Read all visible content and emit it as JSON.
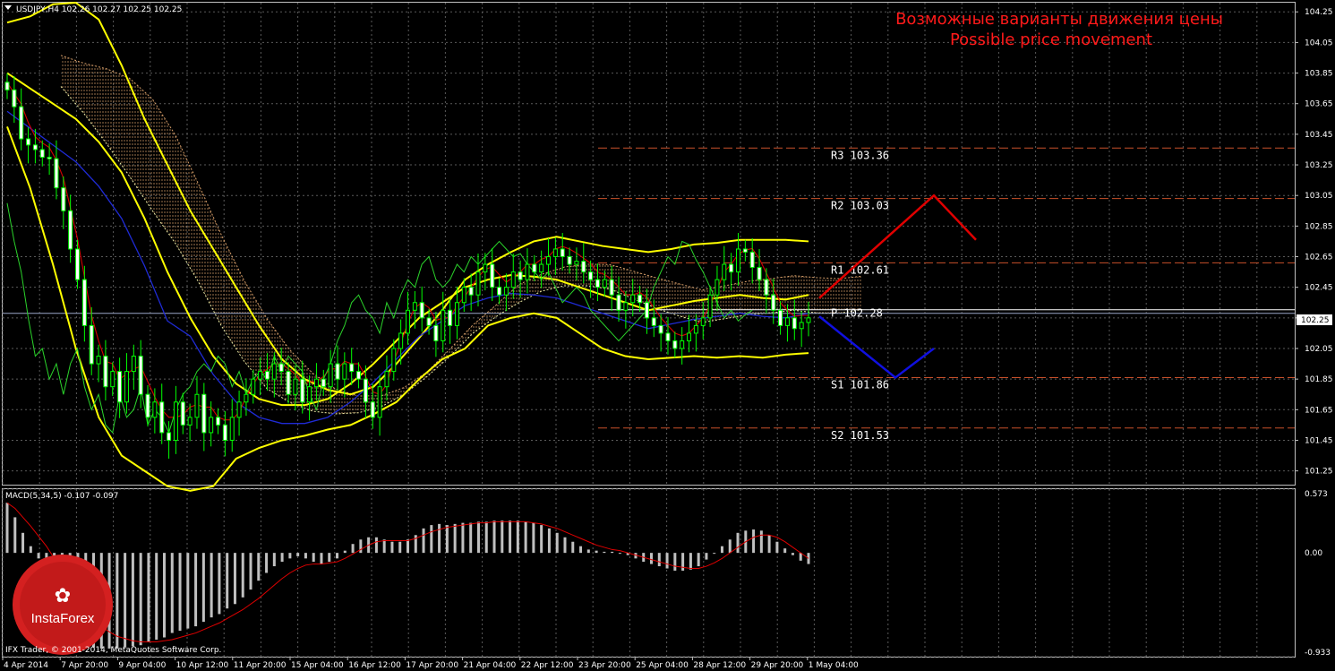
{
  "chart_data": {
    "type": "candlestick",
    "symbol_header": "USDJPY,H4  102.26 102.27 102.25 102.25",
    "annotation": {
      "ru": "Возможные варианты движения цены",
      "en": "Possible price movement"
    },
    "current_price": "102.25",
    "price_axis": {
      "ylim": [
        101.16,
        104.31
      ],
      "ticks": [
        "104.25",
        "104.05",
        "103.85",
        "103.65",
        "103.45",
        "103.25",
        "103.05",
        "102.85",
        "102.65",
        "102.45",
        "102.25",
        "102.05",
        "101.85",
        "101.65",
        "101.45",
        "101.25"
      ]
    },
    "levels": [
      {
        "label": "R3 103.36",
        "value": 103.36,
        "color": "#c8502a",
        "style": "dashed"
      },
      {
        "label": "R2 103.03",
        "value": 103.03,
        "color": "#c8502a",
        "style": "dashed"
      },
      {
        "label": "R1 102.61",
        "value": 102.61,
        "color": "#c8502a",
        "style": "dashed"
      },
      {
        "label": "P 102.28",
        "value": 102.28,
        "color": "#ffffff",
        "style": "solid"
      },
      {
        "label": "S1 101.86",
        "value": 101.86,
        "color": "#c8502a",
        "style": "dashed"
      },
      {
        "label": "S2 101.53",
        "value": 101.53,
        "color": "#c8502a",
        "style": "dashed"
      }
    ],
    "x_labels": [
      "4 Apr 2014",
      "7 Apr 20:00",
      "9 Apr 04:00",
      "10 Apr 12:00",
      "11 Apr 20:00",
      "15 Apr 04:00",
      "16 Apr 12:00",
      "17 Apr 20:00",
      "21 Apr 04:00",
      "22 Apr 12:00",
      "23 Apr 20:00",
      "25 Apr 04:00",
      "28 Apr 12:00",
      "29 Apr 20:00",
      "1 May 04:00"
    ],
    "projections": [
      {
        "name": "bullish",
        "color": "#e00000",
        "points": [
          [
            0,
            102.38
          ],
          [
            1,
            103.05
          ],
          [
            2,
            102.76
          ]
        ]
      },
      {
        "name": "bearish",
        "color": "#1010e0",
        "points": [
          [
            0,
            102.26
          ],
          [
            1,
            101.86
          ],
          [
            2,
            102.05
          ]
        ]
      }
    ],
    "macd": {
      "header": "MACD(5,34,5) -0.107 -0.097",
      "ylim": [
        -0.933,
        0.573
      ],
      "ticks": [
        "0.573",
        "0.00",
        "-0.933"
      ],
      "histogram": [
        0.45,
        0.32,
        0.18,
        0.06,
        -0.05,
        -0.18,
        -0.35,
        -0.55,
        -0.7,
        -0.78,
        -0.82,
        -0.85,
        -0.86,
        -0.86,
        -0.86,
        -0.85,
        -0.84,
        -0.83,
        -0.8,
        -0.78,
        -0.76,
        -0.72,
        -0.7,
        -0.68,
        -0.66,
        -0.62,
        -0.58,
        -0.55,
        -0.5,
        -0.46,
        -0.4,
        -0.33,
        -0.25,
        -0.18,
        -0.12,
        -0.08,
        -0.05,
        -0.03,
        -0.05,
        -0.08,
        -0.1,
        -0.08,
        -0.05,
        0.02,
        0.08,
        0.12,
        0.14,
        0.14,
        0.12,
        0.1,
        0.1,
        0.12,
        0.16,
        0.22,
        0.25,
        0.26,
        0.25,
        0.26,
        0.27,
        0.27,
        0.28,
        0.28,
        0.29,
        0.29,
        0.29,
        0.29,
        0.28,
        0.27,
        0.25,
        0.22,
        0.18,
        0.14,
        0.1,
        0.06,
        0.03,
        0.02,
        0.01,
        0.01,
        0.0,
        -0.02,
        -0.05,
        -0.08,
        -0.1,
        -0.12,
        -0.14,
        -0.16,
        -0.16,
        -0.15,
        -0.12,
        -0.06,
        0.0,
        0.06,
        0.12,
        0.18,
        0.2,
        0.21,
        0.2,
        0.16,
        0.1,
        0.04,
        -0.02,
        -0.07,
        -0.1
      ],
      "signal": [
        0.45,
        0.4,
        0.32,
        0.24,
        0.15,
        0.06,
        -0.05,
        -0.18,
        -0.3,
        -0.42,
        -0.52,
        -0.6,
        -0.66,
        -0.71,
        -0.75,
        -0.77,
        -0.79,
        -0.8,
        -0.8,
        -0.8,
        -0.79,
        -0.78,
        -0.76,
        -0.74,
        -0.72,
        -0.69,
        -0.66,
        -0.63,
        -0.59,
        -0.55,
        -0.51,
        -0.46,
        -0.41,
        -0.35,
        -0.29,
        -0.23,
        -0.18,
        -0.14,
        -0.11,
        -0.1,
        -0.1,
        -0.09,
        -0.08,
        -0.05,
        -0.01,
        0.03,
        0.07,
        0.1,
        0.11,
        0.11,
        0.11,
        0.11,
        0.13,
        0.16,
        0.19,
        0.21,
        0.23,
        0.24,
        0.25,
        0.26,
        0.27,
        0.27,
        0.28,
        0.28,
        0.28,
        0.28,
        0.28,
        0.27,
        0.26,
        0.24,
        0.22,
        0.19,
        0.16,
        0.13,
        0.1,
        0.07,
        0.05,
        0.03,
        0.02,
        0.0,
        -0.02,
        -0.04,
        -0.06,
        -0.08,
        -0.1,
        -0.12,
        -0.13,
        -0.14,
        -0.14,
        -0.12,
        -0.09,
        -0.05,
        0.0,
        0.05,
        0.1,
        0.14,
        0.16,
        0.16,
        0.14,
        0.1,
        0.05,
        0.0,
        -0.05
      ]
    },
    "series": [
      {
        "name": "close",
        "color": "#00ff00",
        "values": [
          103.74,
          103.63,
          103.42,
          103.38,
          103.35,
          103.3,
          103.29,
          103.1,
          102.95,
          102.7,
          102.5,
          102.2,
          101.95,
          102.0,
          101.8,
          101.9,
          101.7,
          101.9,
          102.0,
          101.75,
          101.6,
          101.7,
          101.5,
          101.45,
          101.7,
          101.55,
          101.6,
          101.75,
          101.5,
          101.6,
          101.55,
          101.45,
          101.6,
          101.7,
          101.75,
          101.85,
          101.9,
          101.85,
          101.95,
          101.9,
          101.75,
          101.85,
          101.7,
          101.8,
          101.85,
          101.8,
          101.95,
          101.85,
          101.95,
          101.9,
          101.85,
          101.7,
          101.6,
          101.8,
          101.9,
          102.05,
          102.15,
          102.3,
          102.35,
          102.25,
          102.2,
          102.1,
          102.3,
          102.2,
          102.35,
          102.45,
          102.4,
          102.55,
          102.6,
          102.45,
          102.4,
          102.45,
          102.55,
          102.5,
          102.6,
          102.55,
          102.6,
          102.65,
          102.7,
          102.65,
          102.6,
          102.62,
          102.55,
          102.5,
          102.45,
          102.5,
          102.4,
          102.3,
          102.35,
          102.4,
          102.35,
          102.25,
          102.2,
          102.15,
          102.1,
          102.05,
          102.1,
          102.15,
          102.2,
          102.25,
          102.4,
          102.5,
          102.6,
          102.55,
          102.7,
          102.68,
          102.58,
          102.5,
          102.4,
          102.3,
          102.2,
          102.25,
          102.18,
          102.22,
          102.25
        ]
      },
      {
        "name": "bb_upper",
        "color": "#ffff00",
        "values": [
          104.18,
          104.22,
          104.3,
          104.31,
          104.2,
          103.9,
          103.55,
          103.25,
          102.95,
          102.7,
          102.45,
          102.2,
          101.98,
          101.85,
          101.78,
          101.75,
          101.8,
          101.95,
          102.12,
          102.3,
          102.5,
          102.6,
          102.68,
          102.75,
          102.78,
          102.75,
          102.72,
          102.7,
          102.68,
          102.7,
          102.73,
          102.74,
          102.76,
          102.76,
          102.76,
          102.75
        ]
      },
      {
        "name": "bb_middle",
        "color": "#ffff00",
        "values": [
          103.85,
          103.75,
          103.65,
          103.55,
          103.4,
          103.2,
          102.9,
          102.55,
          102.25,
          102.0,
          101.82,
          101.72,
          101.68,
          101.68,
          101.72,
          101.82,
          101.95,
          102.1,
          102.25,
          102.35,
          102.45,
          102.5,
          102.53,
          102.52,
          102.5,
          102.45,
          102.4,
          102.35,
          102.3,
          102.33,
          102.36,
          102.38,
          102.4,
          102.38,
          102.37,
          102.4
        ]
      },
      {
        "name": "bb_lower",
        "color": "#ffff00",
        "values": [
          103.5,
          103.1,
          102.6,
          102.05,
          101.6,
          101.35,
          101.25,
          101.15,
          101.12,
          101.15,
          101.33,
          101.4,
          101.45,
          101.48,
          101.52,
          101.55,
          101.62,
          101.7,
          101.85,
          101.98,
          102.05,
          102.2,
          102.25,
          102.28,
          102.25,
          102.15,
          102.05,
          102.0,
          101.98,
          101.99,
          102.0,
          101.99,
          102.0,
          101.99,
          102.01,
          102.02
        ]
      }
    ]
  },
  "copyright": "IFX Trader, © 2001-2014, MetaQuotes Software Corp.",
  "logo": {
    "text": "InstaForex",
    "icon": "instaforex-logo-icon"
  }
}
